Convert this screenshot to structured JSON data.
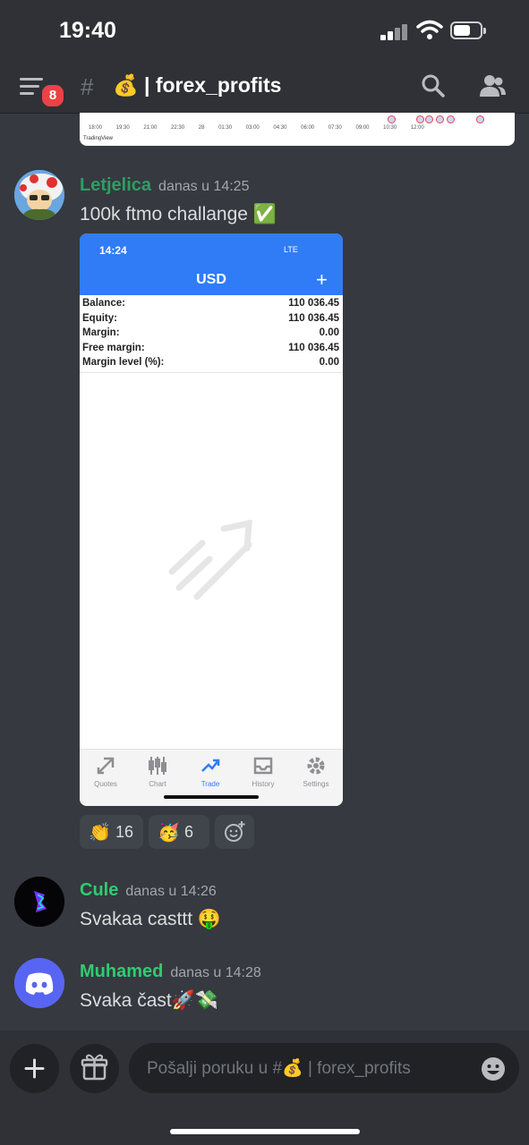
{
  "status_bar": {
    "time": "19:40"
  },
  "header": {
    "menu_badge": "8",
    "hash_symbol": "#",
    "channel_name": "💰 | forex_profits"
  },
  "previous_attachment": {
    "tick_labels": "18:00 19:30 21:00 22:30 28 01:30 03:00 04:30 06:00 07:30 09:00 10:30 12:00",
    "brand": "TradingView"
  },
  "messages": [
    {
      "author": "Letjelica",
      "author_color": "#2d9e66",
      "timestamp": "danas u 14:25",
      "text": "100k ftmo challange ✅",
      "attachment": {
        "time": "14:24",
        "network": "LTE",
        "title": "USD",
        "plus": "+",
        "rows": [
          {
            "label": "Balance:",
            "value": "110 036.45"
          },
          {
            "label": "Equity:",
            "value": "110 036.45"
          },
          {
            "label": "Margin:",
            "value": "0.00"
          },
          {
            "label": "Free margin:",
            "value": "110 036.45"
          },
          {
            "label": "Margin level (%):",
            "value": "0.00"
          }
        ],
        "tabs": [
          {
            "label": "Quotes",
            "icon": "quotes-icon"
          },
          {
            "label": "Chart",
            "icon": "candlestick-icon"
          },
          {
            "label": "Trade",
            "icon": "trade-trend-icon"
          },
          {
            "label": "History",
            "icon": "inbox-icon"
          },
          {
            "label": "Settings",
            "icon": "gear-icon"
          }
        ],
        "active_tab": "Trade"
      },
      "reactions": [
        {
          "emoji": "👏",
          "count": "16"
        },
        {
          "emoji": "🥳",
          "count": "6"
        }
      ]
    },
    {
      "author": "Cule",
      "author_color": "#2ecc71",
      "timestamp": "danas u 14:26",
      "text": "Svakaa casttt 🤑"
    },
    {
      "author": "Muhamed",
      "author_color": "#2ecc71",
      "timestamp": "danas u 14:28",
      "text": "Svaka čast🚀💸"
    }
  ],
  "composer": {
    "placeholder": "Pošalji poruku u #💰 | forex_profits"
  },
  "colors": {
    "accent": "#5865f2",
    "mt_blue": "#2f7cf6",
    "background": "#36393f",
    "header": "#2f3136"
  }
}
